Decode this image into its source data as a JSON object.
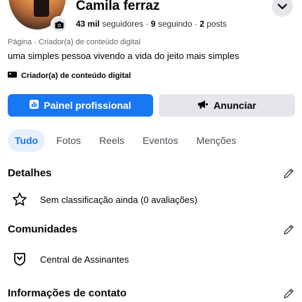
{
  "profile": {
    "name": "Camila ferraz",
    "followers_count": "43 mil",
    "followers_label": "seguidores",
    "following_count": "9",
    "following_label": "seguindo",
    "posts_count": "2",
    "posts_label": "posts",
    "separator": "·",
    "category": "Página · Criador(a) de conteúdo digital",
    "bio": "uma simples pessoa vivendo a vida do jeito mais simples",
    "creator_tag": "Criador(a) de conteúdo digital"
  },
  "actions": {
    "professional_dashboard": "Painel profissional",
    "advertise": "Anunciar"
  },
  "tabs": [
    {
      "label": "Tudo",
      "active": true
    },
    {
      "label": "Fotos",
      "active": false
    },
    {
      "label": "Reels",
      "active": false
    },
    {
      "label": "Eventos",
      "active": false
    },
    {
      "label": "Menções",
      "active": false
    }
  ],
  "sections": {
    "details": {
      "title": "Detalhes",
      "rating_text": "Sem classificação ainda (0 avaliações)"
    },
    "communities": {
      "title": "Comunidades",
      "item": "Central de Assinantes"
    },
    "contact": {
      "title": "Informações de contato"
    }
  },
  "colors": {
    "primary": "#1877f2",
    "secondary_bg": "#e4e6eb",
    "active_tab_bg": "#e7f0fd",
    "muted_text": "#65676b"
  },
  "icons": {
    "camera": "camera-icon",
    "chevron": "chevron-down-icon",
    "creator": "video-camera-icon",
    "dashboard": "bar-chart-icon",
    "advertise": "megaphone-icon",
    "rating": "star-icon",
    "community": "shield-icon",
    "edit": "pencil-icon"
  }
}
